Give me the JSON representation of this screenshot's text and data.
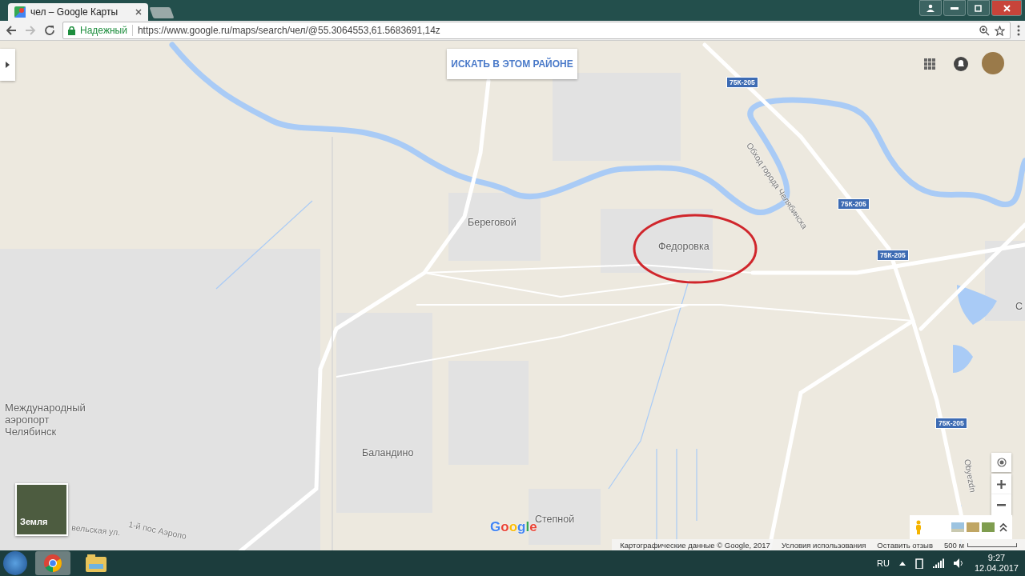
{
  "browser": {
    "tab_title": "чел – Google Карты",
    "security_label": "Надежный",
    "url": "https://www.google.ru/maps/search/чел/@55.3064553,61.5683691,14z"
  },
  "map": {
    "search_area_button": "ИСКАТЬ В ЭТОМ РАЙОНЕ",
    "labels": [
      {
        "kind": "place",
        "text": "Береговой"
      },
      {
        "kind": "place",
        "text": "Федоровка"
      },
      {
        "kind": "place",
        "text": "Международный аэропорт Челябинск"
      },
      {
        "kind": "place",
        "text": "Баландино"
      },
      {
        "kind": "place",
        "text": "Степной"
      },
      {
        "kind": "place",
        "text": "С"
      },
      {
        "kind": "road_name",
        "text": "Обход города Челябинска"
      },
      {
        "kind": "road_name",
        "text": "Obyezdn"
      },
      {
        "kind": "street",
        "text": "вельская ул."
      },
      {
        "kind": "street",
        "text": "1-й пос Аэропо"
      },
      {
        "kind": "badge",
        "text": "75К-205"
      },
      {
        "kind": "badge",
        "text": "75К-205"
      },
      {
        "kind": "badge",
        "text": "75К-205"
      },
      {
        "kind": "badge",
        "text": "75К-205"
      }
    ],
    "layer_toggle": "Земля",
    "logo": "Google",
    "footer": [
      "Картографические данные © Google, 2017",
      "Условия использования",
      "Оставить отзыв"
    ],
    "scale": "500 м"
  },
  "taskbar": {
    "language": "RU",
    "time": "9:27",
    "date": "12.04.2017"
  }
}
